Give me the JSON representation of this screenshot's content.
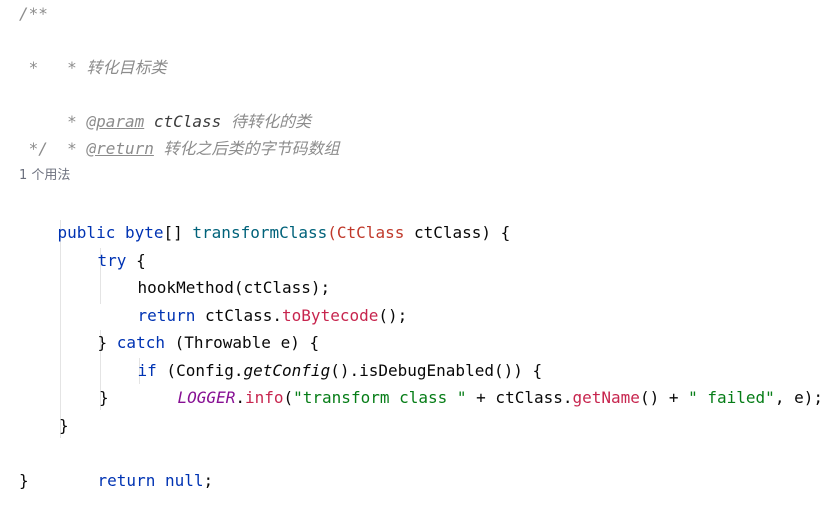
{
  "doc": {
    "open": "/**",
    "line1_star": " * ",
    "line1_text": "转化目标类",
    "line2": " *",
    "line3_star": " * ",
    "line3_tag": "@param",
    "line3_name": "ctClass",
    "line3_desc": "待转化的类",
    "line4_star": " * ",
    "line4_tag": "@return",
    "line4_desc": "转化之后类的字节码数组",
    "close": " */"
  },
  "usage_hint": "1 个用法",
  "code": {
    "sig_public": "public",
    "sig_byte": "byte",
    "sig_brackets": "[] ",
    "sig_method": "transformClass",
    "sig_paren_open": "(",
    "sig_param_type": "CtClass",
    "sig_param_rest": " ctClass) {",
    "try_kw": "try",
    "try_brace": " {",
    "hook_call": "hookMethod(ctClass);",
    "return_kw": "return",
    "return_obj": " ctClass.",
    "return_method": "toBytecode",
    "return_end": "();",
    "catch_open": "} ",
    "catch_kw": "catch",
    "catch_rest": " (Throwable e) {",
    "if_kw": "if",
    "if_p1": " (Config.",
    "if_static": "getConfig",
    "if_p2": "().isDebugEnabled()) {",
    "log_field": "LOGGER",
    "log_dot": ".",
    "log_method": "info",
    "log_p1": "(",
    "log_str1": "\"transform class \"",
    "log_p2": " + ctClass.",
    "log_getname": "getName",
    "log_p3": "() + ",
    "log_str2": "\" failed\"",
    "log_p4": ", e);",
    "close_if": "}",
    "close_catch": "}",
    "return2_kw": "return",
    "return2_null": " null",
    "return2_semi": ";",
    "close_method": "}"
  },
  "colors": {
    "keyword": "#0033b3",
    "method_decl": "#00627a",
    "string": "#067d17",
    "static_field": "#871094",
    "comment": "#8c8c8c",
    "class_ref": "#c0392b",
    "method_call": "#c7254e"
  }
}
